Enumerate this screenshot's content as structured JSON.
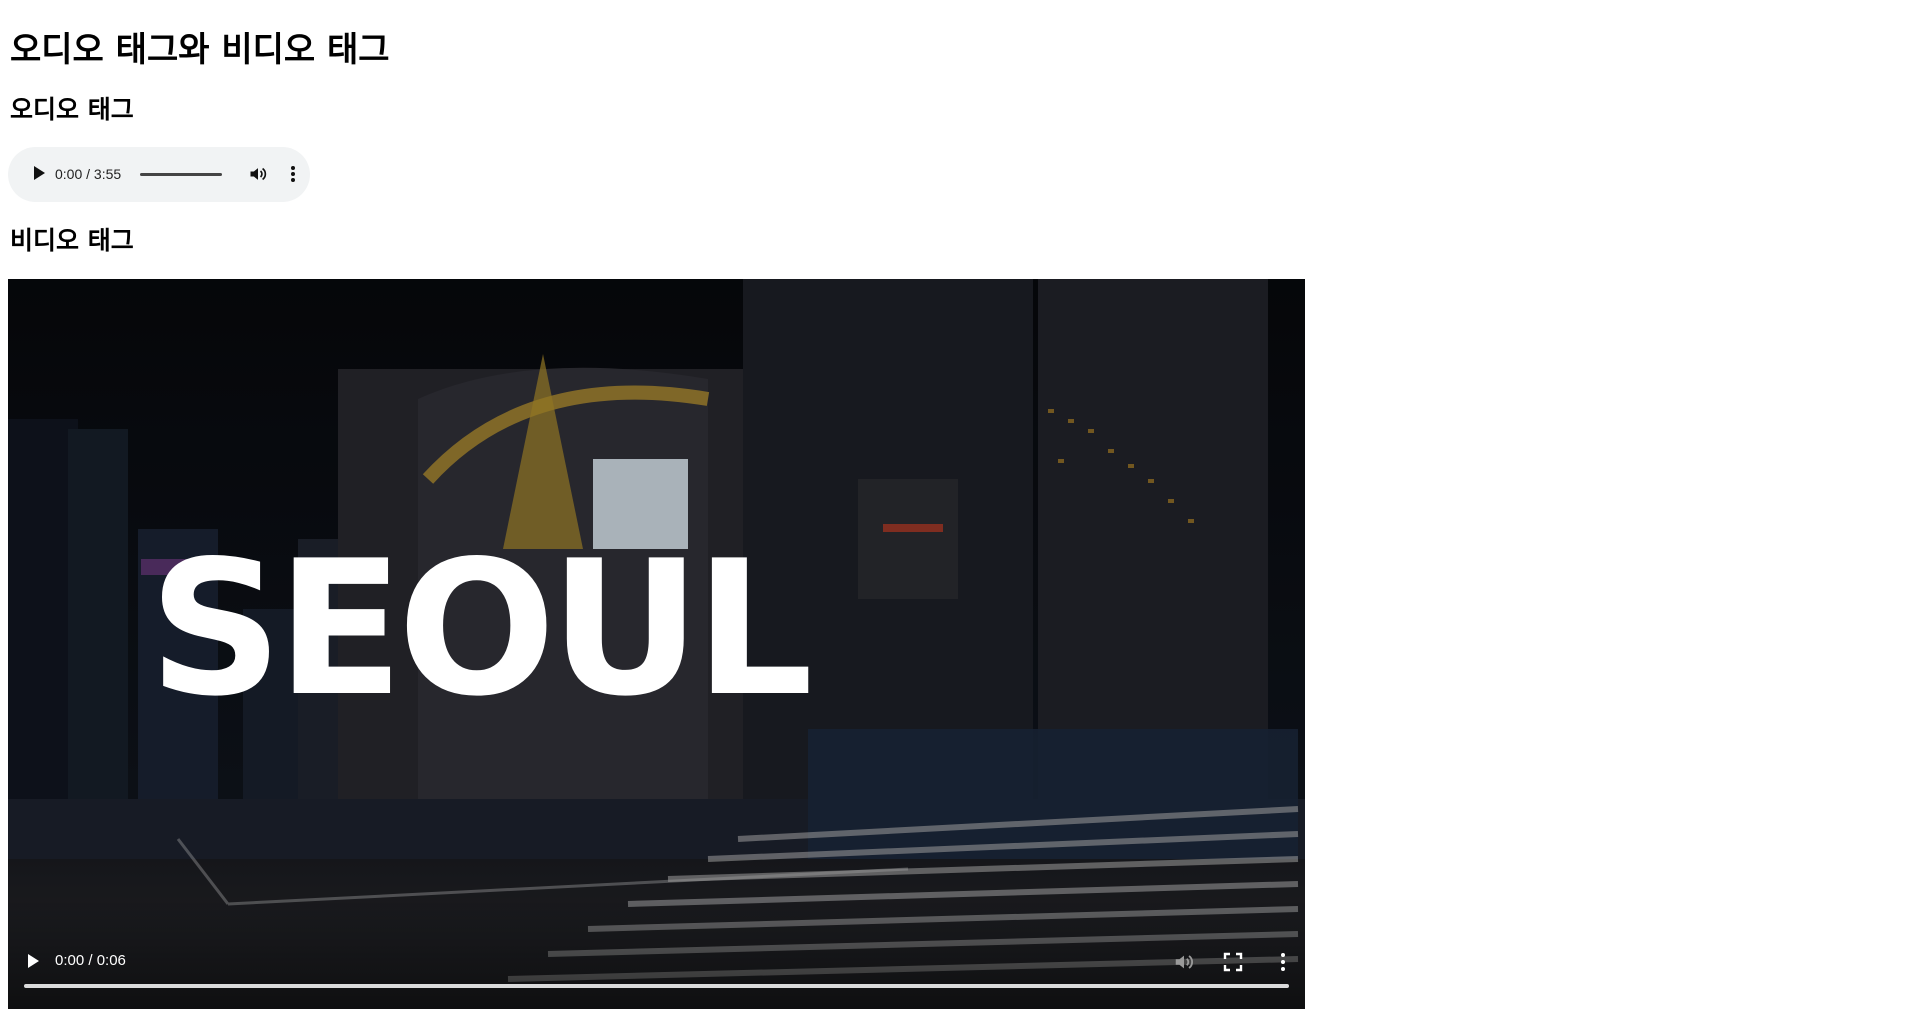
{
  "page": {
    "title": "오디오 태그와 비디오 태그",
    "audio_heading": "오디오 태그",
    "video_heading": "비디오 태그"
  },
  "audio_player": {
    "time": "0:00 / 3:55",
    "progress": 0,
    "icons": [
      "play-icon",
      "volume-icon",
      "more-options-icon"
    ]
  },
  "video_player": {
    "poster_text": "SEOUL",
    "time": "0:00 / 0:06",
    "progress": 0,
    "icons": [
      "play-icon",
      "mute-icon",
      "fullscreen-icon",
      "more-options-icon"
    ]
  }
}
